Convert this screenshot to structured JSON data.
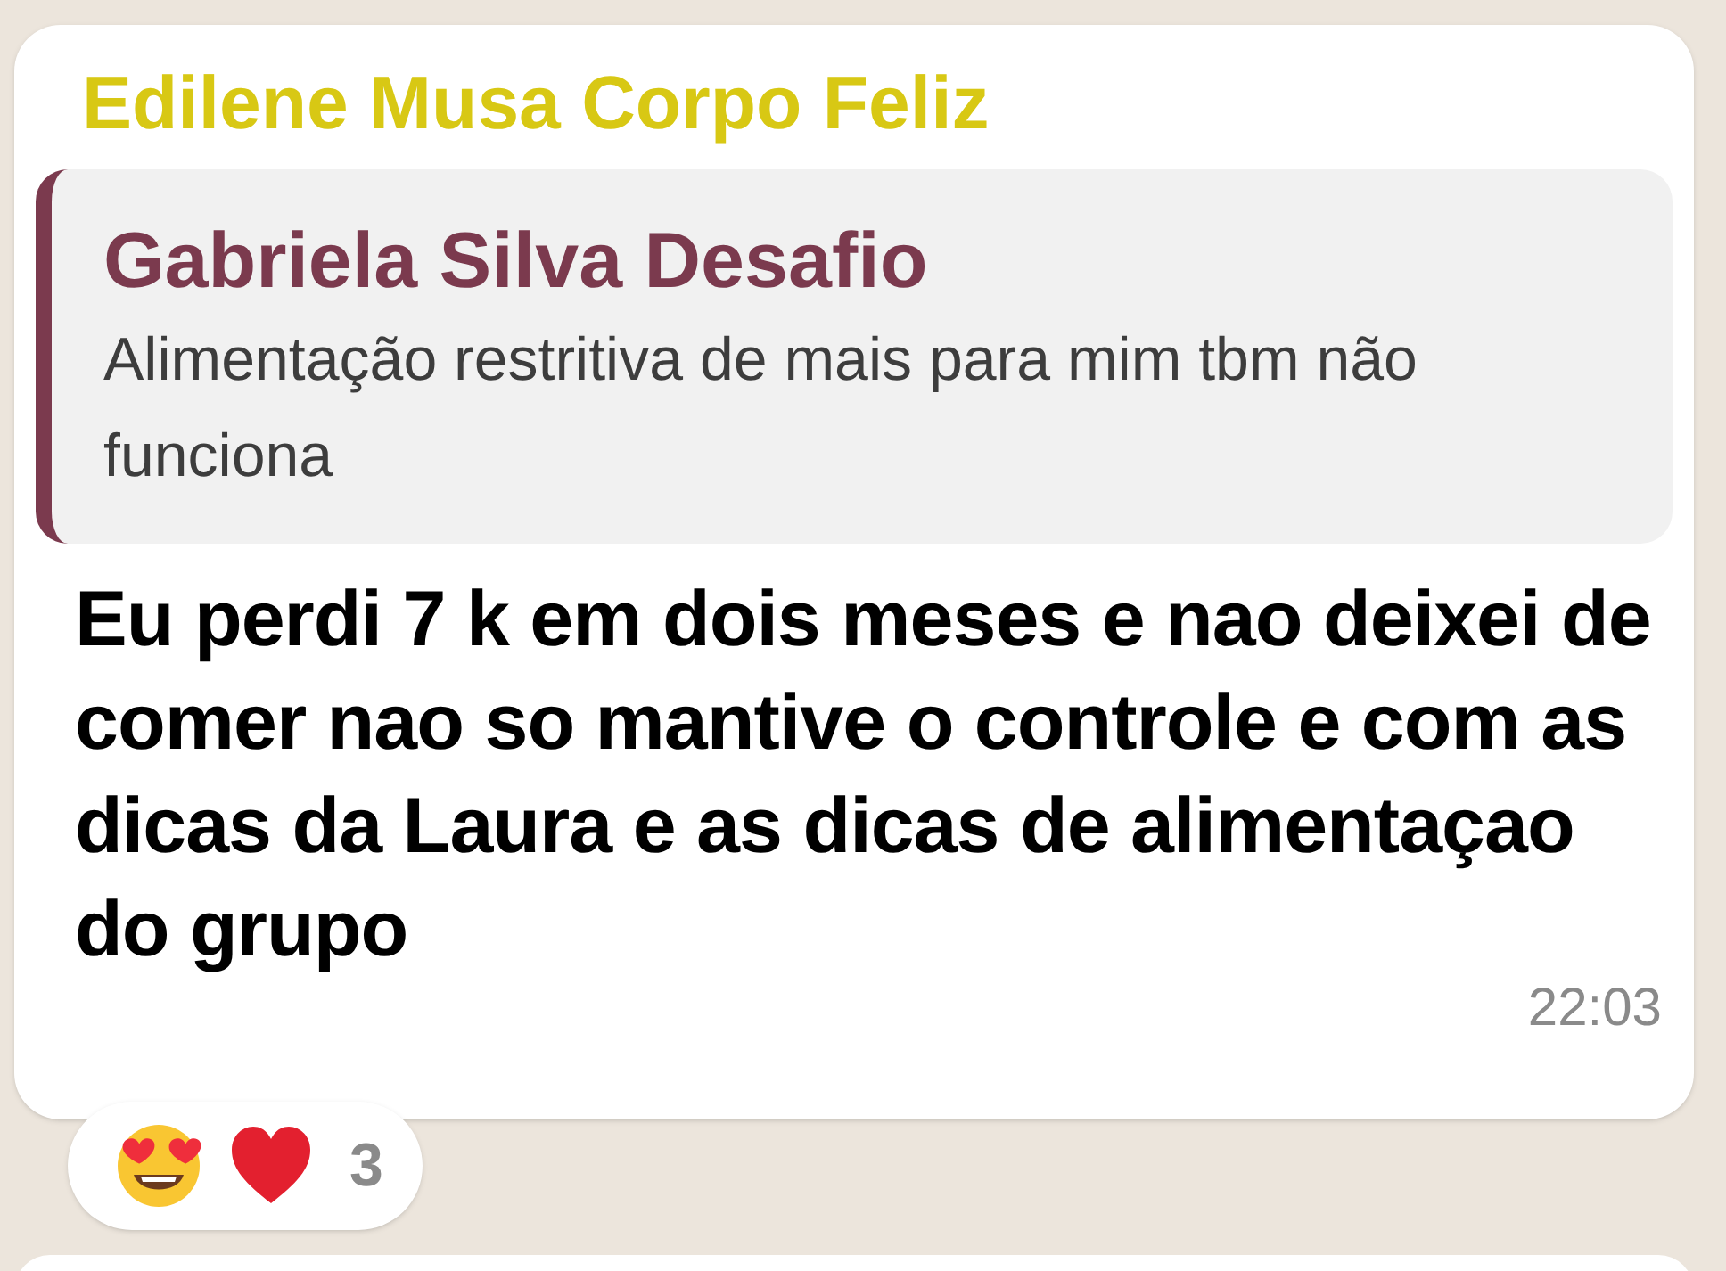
{
  "message": {
    "sender": "Edilene Musa Corpo Feliz",
    "quote": {
      "author": "Gabriela Silva Desafio",
      "text": "Alimentação restritiva de mais para mim tbm não funciona"
    },
    "text": "Eu perdi 7 k em dois meses e nao deixei de comer nao so mantive o controle e com as dicas da Laura e as dicas de alimentaçao do grupo",
    "time": "22:03",
    "reactions": {
      "emojis": [
        {
          "kind": "heart-eyes"
        },
        {
          "kind": "heart"
        }
      ],
      "count": "3"
    }
  }
}
